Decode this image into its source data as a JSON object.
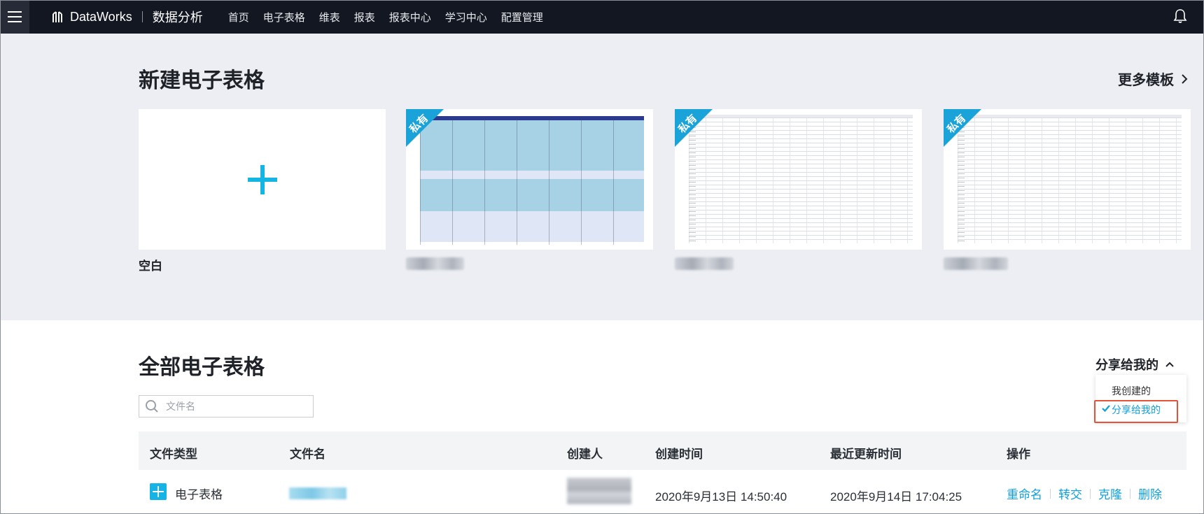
{
  "topbar": {
    "brand": "DataWorks",
    "product": "数据分析",
    "nav": [
      "首页",
      "电子表格",
      "维表",
      "报表",
      "报表中心",
      "学习中心",
      "配置管理"
    ]
  },
  "new_section": {
    "title": "新建电子表格",
    "more_templates": "更多模板",
    "blank_label": "空白",
    "private_badge": "私有"
  },
  "all_section": {
    "title": "全部电子表格",
    "search_placeholder": "文件名",
    "filter": {
      "current": "分享给我的",
      "options": [
        "我创建的",
        "分享给我的"
      ]
    },
    "columns": [
      "文件类型",
      "文件名",
      "创建人",
      "创建时间",
      "最近更新时间",
      "操作"
    ],
    "rows": [
      {
        "type": "电子表格",
        "created": "2020年9月13日 14:50:40",
        "updated": "2020年9月14日 17:04:25",
        "actions": [
          "重命名",
          "转交",
          "克隆",
          "删除"
        ]
      }
    ]
  },
  "colors": {
    "accent": "#0f9fd9",
    "topbar": "#131722",
    "highlight_border": "#e0553a"
  }
}
